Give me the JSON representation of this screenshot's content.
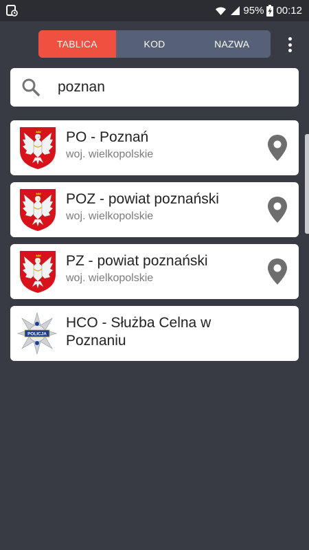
{
  "status_bar": {
    "battery": "95%",
    "time": "00:12"
  },
  "tabs": [
    {
      "label": "TABLICA",
      "active": true
    },
    {
      "label": "KOD",
      "active": false
    },
    {
      "label": "NAZWA",
      "active": false
    }
  ],
  "search": {
    "value": "poznan",
    "placeholder": ""
  },
  "results": [
    {
      "title": "PO - Poznań",
      "subtitle": "woj. wielkopolskie",
      "emblem": "wielkopolska-eagle-emblem",
      "has_location": true
    },
    {
      "title": "POZ - powiat poznański",
      "subtitle": "woj. wielkopolskie",
      "emblem": "wielkopolska-eagle-emblem",
      "has_location": true
    },
    {
      "title": "PZ - powiat poznański",
      "subtitle": "woj. wielkopolskie",
      "emblem": "wielkopolska-eagle-emblem",
      "has_location": true
    },
    {
      "title": "HCO - Służba Celna w Poznaniu",
      "subtitle": "",
      "emblem": "policja-star-badge",
      "emblem_text": "POLICJA",
      "has_location": false
    }
  ],
  "colors": {
    "background": "#383b44",
    "status_bar": "#2b2d33",
    "tab_active": "#ef5040",
    "tab_inactive": "#566178",
    "pin": "#6e6e6e"
  }
}
